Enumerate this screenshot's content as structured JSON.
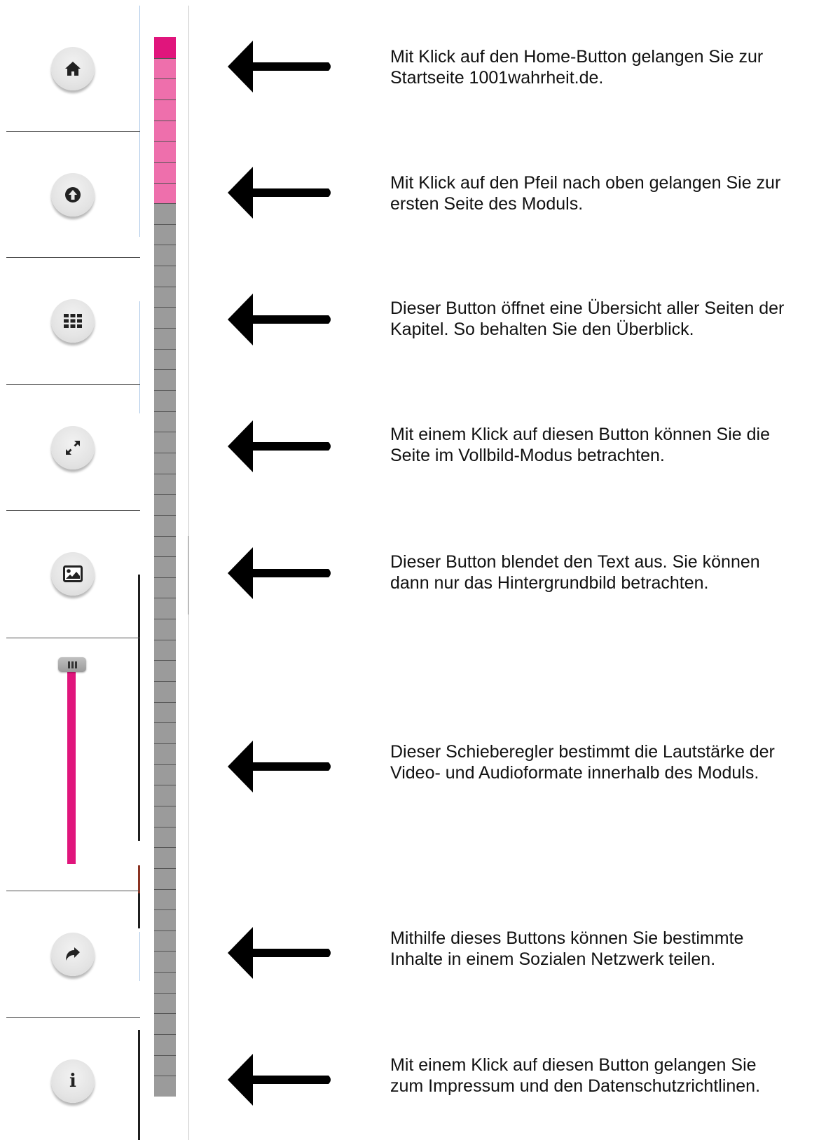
{
  "sidebar": {
    "buttons": [
      {
        "icon": "home-icon"
      },
      {
        "icon": "arrow-up-circle-icon"
      },
      {
        "icon": "grid-icon"
      },
      {
        "icon": "fullscreen-icon"
      },
      {
        "icon": "image-icon"
      },
      {
        "icon": "share-icon"
      },
      {
        "icon": "info-icon",
        "glyph": "i"
      }
    ],
    "volume_slider": {
      "level": 1.0,
      "handle_icon": "slider-grip-icon",
      "color": "#e0157c"
    }
  },
  "progress": {
    "total_pages": 51,
    "visited_pages": 8,
    "current_page": 1,
    "current_color": "#e0157c",
    "visited_color": "#ee6fac",
    "unvisited_color": "#9b9b9b"
  },
  "annotations": [
    {
      "text": "Mit Klick auf den Home-Button gelangen Sie zur\nStartseite 1001wahrheit.de."
    },
    {
      "text": "Mit Klick auf den Pfeil nach oben gelangen Sie zur\nersten Seite des Moduls."
    },
    {
      "text": "Dieser Button öffnet eine Übersicht aller Seiten der\nKapitel. So behalten Sie den Überblick."
    },
    {
      "text": "Mit einem Klick auf diesen Button können Sie die\nSeite im Vollbild-Modus betrachten."
    },
    {
      "text": "Dieser Button blendet den Text aus. Sie können\ndann nur das Hintergrundbild betrachten."
    },
    {
      "text": "Dieser Schieberegler bestimmt die Lautstärke der\nVideo- und Audioformate innerhalb des Moduls."
    },
    {
      "text": "Mithilfe dieses Buttons können Sie bestimmte\nInhalte in einem Sozialen Netzwerk teilen."
    },
    {
      "text": "Mit einem Klick auf diesen Button gelangen Sie\nzum Impressum und den Datenschutzrichtlinen."
    }
  ],
  "arrow_icon": "left-arrow-icon"
}
